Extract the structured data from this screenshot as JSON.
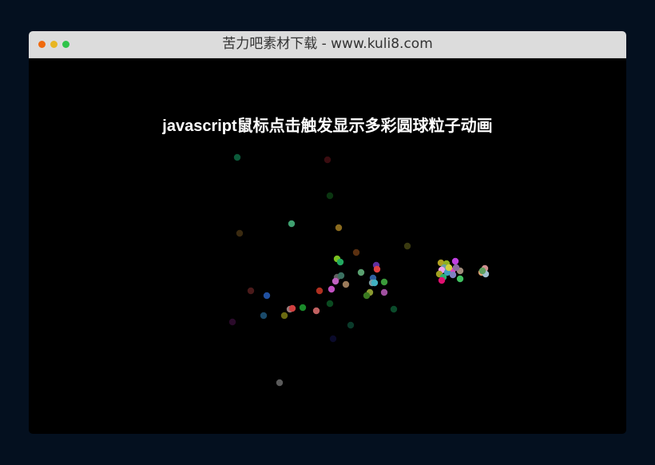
{
  "window": {
    "title": "苦力吧素材下载 - www.kuli8.com",
    "controls": {
      "close_color": "#f06a0e",
      "minimize_color": "#e8b622",
      "zoom_color": "#2fc44a"
    }
  },
  "page": {
    "heading": "javascript鼠标点击触发显示多彩圆球粒子动画",
    "background_color": "#000000"
  }
}
